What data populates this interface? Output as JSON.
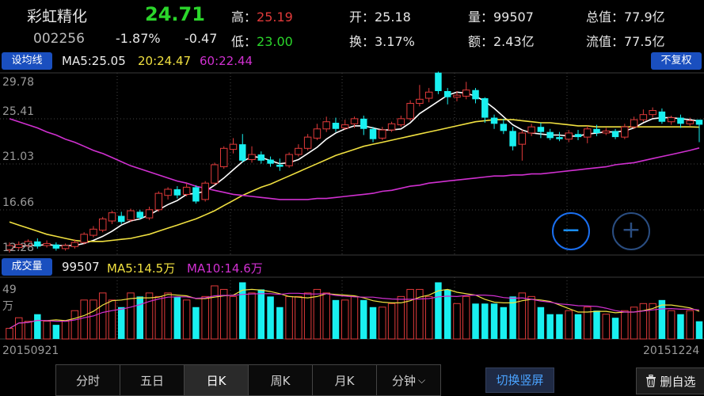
{
  "stock": {
    "name": "彩虹精化",
    "code": "002256",
    "price": "24.71",
    "change_pct": "-1.87%",
    "change": "-0.47",
    "high_label": "高：",
    "high": "25.19",
    "low_label": "低：",
    "low": "23.00",
    "open": "开：25.18",
    "turnover": "换：3.17%",
    "volume": "量：99507",
    "amount": "额：2.43亿",
    "total_value": "总值：77.9亿",
    "float_value": "流值：77.5亿"
  },
  "toolbar": {
    "ma_button": "设均线",
    "adjust_button": "不复权",
    "volume_button": "成交量"
  },
  "ma_legend": {
    "ma5": "MA5:25.05",
    "ma20": "20:24.47",
    "ma60": "60:22.44"
  },
  "vol_legend": {
    "volume": "99507",
    "ma5": "MA5:14.5万",
    "ma10": "MA10:14.6万"
  },
  "axis": {
    "price_ticks": [
      "29.78",
      "25.41",
      "21.03",
      "16.66",
      "12.28"
    ],
    "vol_ticks": [
      "49",
      "万"
    ],
    "start_date": "20150921",
    "end_date": "20151224"
  },
  "zoom": {
    "out": "−",
    "in": "+"
  },
  "tabs": [
    "分时",
    "五日",
    "日K",
    "周K",
    "月K",
    "分钟"
  ],
  "active_tab": "日K",
  "switch_button": "切换竖屏",
  "delete_button": "删自选",
  "colors": {
    "up": "#e03a3a",
    "down": "#19f0f0",
    "ma5": "#ffffff",
    "ma20": "#f0e040",
    "ma60": "#d030d0"
  },
  "chart_data": {
    "type": "candlestick",
    "candles": [
      {
        "o": 12.5,
        "c": 12.9,
        "h": 13.2,
        "l": 12.2
      },
      {
        "o": 12.7,
        "c": 13.0,
        "h": 13.3,
        "l": 12.5
      },
      {
        "o": 12.9,
        "c": 13.3,
        "h": 13.5,
        "l": 12.7
      },
      {
        "o": 13.3,
        "c": 12.8,
        "h": 13.6,
        "l": 12.6
      },
      {
        "o": 12.9,
        "c": 13.1,
        "h": 13.4,
        "l": 12.7
      },
      {
        "o": 13.0,
        "c": 12.6,
        "h": 13.2,
        "l": 12.4
      },
      {
        "o": 12.6,
        "c": 12.9,
        "h": 13.1,
        "l": 12.4
      },
      {
        "o": 12.8,
        "c": 13.2,
        "h": 13.5,
        "l": 12.6
      },
      {
        "o": 13.2,
        "c": 14.0,
        "h": 14.2,
        "l": 13.0
      },
      {
        "o": 13.9,
        "c": 14.5,
        "h": 14.8,
        "l": 13.7
      },
      {
        "o": 14.4,
        "c": 15.5,
        "h": 15.7,
        "l": 14.2
      },
      {
        "o": 15.3,
        "c": 16.1,
        "h": 16.3,
        "l": 15.0
      },
      {
        "o": 15.8,
        "c": 15.2,
        "h": 16.2,
        "l": 15.0
      },
      {
        "o": 15.4,
        "c": 16.3,
        "h": 16.5,
        "l": 15.2
      },
      {
        "o": 16.2,
        "c": 15.6,
        "h": 16.4,
        "l": 15.4
      },
      {
        "o": 15.6,
        "c": 16.4,
        "h": 16.7,
        "l": 15.4
      },
      {
        "o": 16.4,
        "c": 18.0,
        "h": 18.2,
        "l": 16.2
      },
      {
        "o": 17.8,
        "c": 18.4,
        "h": 18.6,
        "l": 17.4
      },
      {
        "o": 18.4,
        "c": 17.8,
        "h": 18.7,
        "l": 17.5
      },
      {
        "o": 17.9,
        "c": 18.6,
        "h": 19.0,
        "l": 17.7
      },
      {
        "o": 18.6,
        "c": 17.2,
        "h": 18.8,
        "l": 17.0
      },
      {
        "o": 17.4,
        "c": 19.0,
        "h": 19.2,
        "l": 17.2
      },
      {
        "o": 19.0,
        "c": 20.8,
        "h": 21.0,
        "l": 18.8
      },
      {
        "o": 20.6,
        "c": 22.4,
        "h": 22.6,
        "l": 20.4
      },
      {
        "o": 22.3,
        "c": 22.8,
        "h": 23.4,
        "l": 21.9
      },
      {
        "o": 22.8,
        "c": 21.2,
        "h": 23.8,
        "l": 21.0
      },
      {
        "o": 21.3,
        "c": 21.8,
        "h": 22.6,
        "l": 21.0
      },
      {
        "o": 21.8,
        "c": 21.2,
        "h": 22.1,
        "l": 20.9
      },
      {
        "o": 21.3,
        "c": 20.9,
        "h": 21.6,
        "l": 20.6
      },
      {
        "o": 20.8,
        "c": 20.6,
        "h": 21.4,
        "l": 20.2
      },
      {
        "o": 20.7,
        "c": 21.8,
        "h": 22.0,
        "l": 20.5
      },
      {
        "o": 21.8,
        "c": 22.4,
        "h": 22.8,
        "l": 21.6
      },
      {
        "o": 22.4,
        "c": 23.5,
        "h": 23.8,
        "l": 22.2
      },
      {
        "o": 23.4,
        "c": 24.3,
        "h": 24.8,
        "l": 23.2
      },
      {
        "o": 24.3,
        "c": 25.0,
        "h": 25.5,
        "l": 24.0
      },
      {
        "o": 24.9,
        "c": 24.3,
        "h": 25.4,
        "l": 24.0
      },
      {
        "o": 24.4,
        "c": 24.7,
        "h": 25.2,
        "l": 24.2
      },
      {
        "o": 24.8,
        "c": 25.3,
        "h": 25.5,
        "l": 24.4
      },
      {
        "o": 25.3,
        "c": 24.3,
        "h": 25.6,
        "l": 23.7
      },
      {
        "o": 24.3,
        "c": 23.3,
        "h": 24.5,
        "l": 23.0
      },
      {
        "o": 23.4,
        "c": 24.2,
        "h": 24.5,
        "l": 23.2
      },
      {
        "o": 24.2,
        "c": 24.8,
        "h": 25.0,
        "l": 24.0
      },
      {
        "o": 24.7,
        "c": 25.3,
        "h": 25.6,
        "l": 24.5
      },
      {
        "o": 25.3,
        "c": 26.8,
        "h": 27.1,
        "l": 25.1
      },
      {
        "o": 26.8,
        "c": 27.2,
        "h": 28.6,
        "l": 26.5
      },
      {
        "o": 27.3,
        "c": 27.9,
        "h": 28.3,
        "l": 26.9
      },
      {
        "o": 29.8,
        "c": 28.0,
        "h": 29.9,
        "l": 27.7
      },
      {
        "o": 28.0,
        "c": 27.4,
        "h": 28.3,
        "l": 26.7
      },
      {
        "o": 27.4,
        "c": 27.6,
        "h": 28.0,
        "l": 27.0
      },
      {
        "o": 27.5,
        "c": 28.1,
        "h": 28.9,
        "l": 27.2
      },
      {
        "o": 28.1,
        "c": 27.2,
        "h": 28.3,
        "l": 26.8
      },
      {
        "o": 27.3,
        "c": 25.4,
        "h": 27.4,
        "l": 24.9
      },
      {
        "o": 25.4,
        "c": 24.8,
        "h": 25.7,
        "l": 24.3
      },
      {
        "o": 24.8,
        "c": 24.1,
        "h": 25.3,
        "l": 23.8
      },
      {
        "o": 24.1,
        "c": 22.6,
        "h": 24.5,
        "l": 22.2
      },
      {
        "o": 22.8,
        "c": 23.9,
        "h": 24.2,
        "l": 21.2
      },
      {
        "o": 23.9,
        "c": 24.5,
        "h": 24.8,
        "l": 23.6
      },
      {
        "o": 24.5,
        "c": 24.0,
        "h": 24.9,
        "l": 23.4
      },
      {
        "o": 24.0,
        "c": 23.4,
        "h": 24.3,
        "l": 23.2
      },
      {
        "o": 23.5,
        "c": 23.3,
        "h": 24.0,
        "l": 23.1
      },
      {
        "o": 23.3,
        "c": 23.9,
        "h": 24.2,
        "l": 23.0
      },
      {
        "o": 23.8,
        "c": 23.5,
        "h": 24.2,
        "l": 23.2
      },
      {
        "o": 23.5,
        "c": 24.3,
        "h": 24.6,
        "l": 22.9
      },
      {
        "o": 24.3,
        "c": 23.9,
        "h": 24.7,
        "l": 23.6
      },
      {
        "o": 23.9,
        "c": 24.1,
        "h": 24.4,
        "l": 23.7
      },
      {
        "o": 24.1,
        "c": 23.5,
        "h": 24.3,
        "l": 23.3
      },
      {
        "o": 23.5,
        "c": 24.5,
        "h": 24.8,
        "l": 23.3
      },
      {
        "o": 24.5,
        "c": 25.2,
        "h": 25.5,
        "l": 24.3
      },
      {
        "o": 25.2,
        "c": 25.7,
        "h": 26.2,
        "l": 25.0
      },
      {
        "o": 25.7,
        "c": 26.1,
        "h": 26.4,
        "l": 25.4
      },
      {
        "o": 26.0,
        "c": 25.0,
        "h": 26.3,
        "l": 24.8
      },
      {
        "o": 25.0,
        "c": 25.4,
        "h": 25.6,
        "l": 24.7
      },
      {
        "o": 25.4,
        "c": 24.8,
        "h": 25.7,
        "l": 24.4
      },
      {
        "o": 24.8,
        "c": 25.1,
        "h": 25.4,
        "l": 24.6
      },
      {
        "o": 25.2,
        "c": 24.71,
        "h": 25.19,
        "l": 23.0
      }
    ],
    "volume": [
      {
        "v": 3,
        "up": true
      },
      {
        "v": 6,
        "up": true
      },
      {
        "v": 5,
        "up": true
      },
      {
        "v": 7,
        "up": false
      },
      {
        "v": 5,
        "up": true
      },
      {
        "v": 4,
        "up": false
      },
      {
        "v": 5,
        "up": true
      },
      {
        "v": 8,
        "up": true
      },
      {
        "v": 11,
        "up": true
      },
      {
        "v": 11,
        "up": true
      },
      {
        "v": 13,
        "up": true
      },
      {
        "v": 11,
        "up": true
      },
      {
        "v": 9,
        "up": false
      },
      {
        "v": 13,
        "up": true
      },
      {
        "v": 12,
        "up": false
      },
      {
        "v": 13,
        "up": true
      },
      {
        "v": 12,
        "up": true
      },
      {
        "v": 13,
        "up": true
      },
      {
        "v": 12,
        "up": false
      },
      {
        "v": 11,
        "up": true
      },
      {
        "v": 9,
        "up": false
      },
      {
        "v": 12,
        "up": true
      },
      {
        "v": 15,
        "up": true
      },
      {
        "v": 14,
        "up": true
      },
      {
        "v": 12,
        "up": true
      },
      {
        "v": 16,
        "up": false
      },
      {
        "v": 13,
        "up": true
      },
      {
        "v": 14,
        "up": false
      },
      {
        "v": 12,
        "up": false
      },
      {
        "v": 9,
        "up": false
      },
      {
        "v": 12,
        "up": true
      },
      {
        "v": 12,
        "up": true
      },
      {
        "v": 13,
        "up": true
      },
      {
        "v": 14,
        "up": true
      },
      {
        "v": 13,
        "up": true
      },
      {
        "v": 11,
        "up": false
      },
      {
        "v": 11,
        "up": true
      },
      {
        "v": 12,
        "up": true
      },
      {
        "v": 11,
        "up": false
      },
      {
        "v": 9,
        "up": false
      },
      {
        "v": 9,
        "up": true
      },
      {
        "v": 10,
        "up": true
      },
      {
        "v": 12,
        "up": true
      },
      {
        "v": 14,
        "up": true
      },
      {
        "v": 14,
        "up": true
      },
      {
        "v": 12,
        "up": true
      },
      {
        "v": 16,
        "up": false
      },
      {
        "v": 14,
        "up": false
      },
      {
        "v": 10,
        "up": true
      },
      {
        "v": 12,
        "up": true
      },
      {
        "v": 10,
        "up": false
      },
      {
        "v": 10,
        "up": false
      },
      {
        "v": 10,
        "up": false
      },
      {
        "v": 9,
        "up": false
      },
      {
        "v": 12,
        "up": false
      },
      {
        "v": 13,
        "up": true
      },
      {
        "v": 12,
        "up": true
      },
      {
        "v": 9,
        "up": false
      },
      {
        "v": 7,
        "up": false
      },
      {
        "v": 7,
        "up": false
      },
      {
        "v": 8,
        "up": true
      },
      {
        "v": 7,
        "up": false
      },
      {
        "v": 9,
        "up": true
      },
      {
        "v": 8,
        "up": false
      },
      {
        "v": 7,
        "up": true
      },
      {
        "v": 6,
        "up": false
      },
      {
        "v": 8,
        "up": true
      },
      {
        "v": 9,
        "up": true
      },
      {
        "v": 10,
        "up": true
      },
      {
        "v": 10,
        "up": true
      },
      {
        "v": 11,
        "up": false
      },
      {
        "v": 8,
        "up": true
      },
      {
        "v": 7,
        "up": false
      },
      {
        "v": 8,
        "up": true
      },
      {
        "v": 5,
        "up": false
      }
    ],
    "ma_lines": [
      {
        "name": "MA5",
        "color": "#ffffff",
        "values": [
          12.7,
          12.8,
          12.9,
          12.9,
          13.0,
          12.9,
          12.9,
          12.9,
          13.1,
          13.4,
          13.8,
          14.3,
          14.9,
          15.3,
          15.5,
          15.9,
          16.4,
          16.9,
          17.3,
          17.9,
          18.0,
          18.2,
          18.8,
          19.5,
          20.3,
          21.1,
          21.6,
          21.5,
          21.2,
          20.9,
          21.0,
          21.3,
          21.9,
          22.5,
          23.3,
          23.9,
          24.3,
          24.6,
          24.6,
          24.4,
          24.2,
          24.2,
          24.3,
          24.9,
          25.8,
          26.4,
          27.0,
          27.6,
          27.9,
          27.8,
          27.5,
          27.0,
          26.3,
          25.5,
          24.7,
          24.2,
          23.9,
          23.8,
          23.7,
          23.7,
          23.6,
          23.6,
          23.8,
          23.9,
          24.0,
          24.0,
          24.1,
          24.4,
          24.9,
          25.3,
          25.4,
          25.4,
          25.3,
          25.2,
          25.05
        ]
      },
      {
        "name": "MA20",
        "color": "#f0e040",
        "values": [
          15.2,
          14.9,
          14.6,
          14.3,
          14.0,
          13.8,
          13.6,
          13.4,
          13.3,
          13.3,
          13.3,
          13.4,
          13.5,
          13.6,
          13.8,
          14.0,
          14.3,
          14.6,
          14.9,
          15.2,
          15.5,
          15.9,
          16.3,
          16.8,
          17.3,
          17.8,
          18.2,
          18.6,
          18.9,
          19.3,
          19.7,
          20.1,
          20.5,
          20.9,
          21.3,
          21.7,
          22.0,
          22.3,
          22.6,
          22.8,
          23.0,
          23.2,
          23.4,
          23.6,
          23.8,
          24.0,
          24.2,
          24.4,
          24.6,
          24.8,
          25.0,
          25.1,
          25.2,
          25.2,
          25.2,
          25.1,
          25.0,
          24.9,
          24.9,
          24.8,
          24.7,
          24.6,
          24.6,
          24.5,
          24.5,
          24.5,
          24.5,
          24.5,
          24.5,
          24.5,
          24.5,
          24.5,
          24.5,
          24.5,
          24.47
        ]
      },
      {
        "name": "MA60",
        "color": "#d030d0",
        "values": [
          25.3,
          25.0,
          24.7,
          24.4,
          24.0,
          23.7,
          23.3,
          23.0,
          22.6,
          22.2,
          21.9,
          21.5,
          21.1,
          20.7,
          20.4,
          20.1,
          19.8,
          19.5,
          19.2,
          19.0,
          18.7,
          18.5,
          18.3,
          18.1,
          17.9,
          17.8,
          17.7,
          17.6,
          17.5,
          17.4,
          17.4,
          17.4,
          17.4,
          17.5,
          17.5,
          17.6,
          17.7,
          17.8,
          17.9,
          18.0,
          18.2,
          18.3,
          18.5,
          18.7,
          18.8,
          19.0,
          19.1,
          19.2,
          19.3,
          19.4,
          19.5,
          19.6,
          19.7,
          19.7,
          19.8,
          19.8,
          19.9,
          19.9,
          20.0,
          20.1,
          20.2,
          20.3,
          20.4,
          20.5,
          20.6,
          20.8,
          20.9,
          21.0,
          21.2,
          21.4,
          21.6,
          21.8,
          22.0,
          22.2,
          22.44
        ]
      }
    ],
    "ylim": [
      12.28,
      29.78
    ]
  }
}
